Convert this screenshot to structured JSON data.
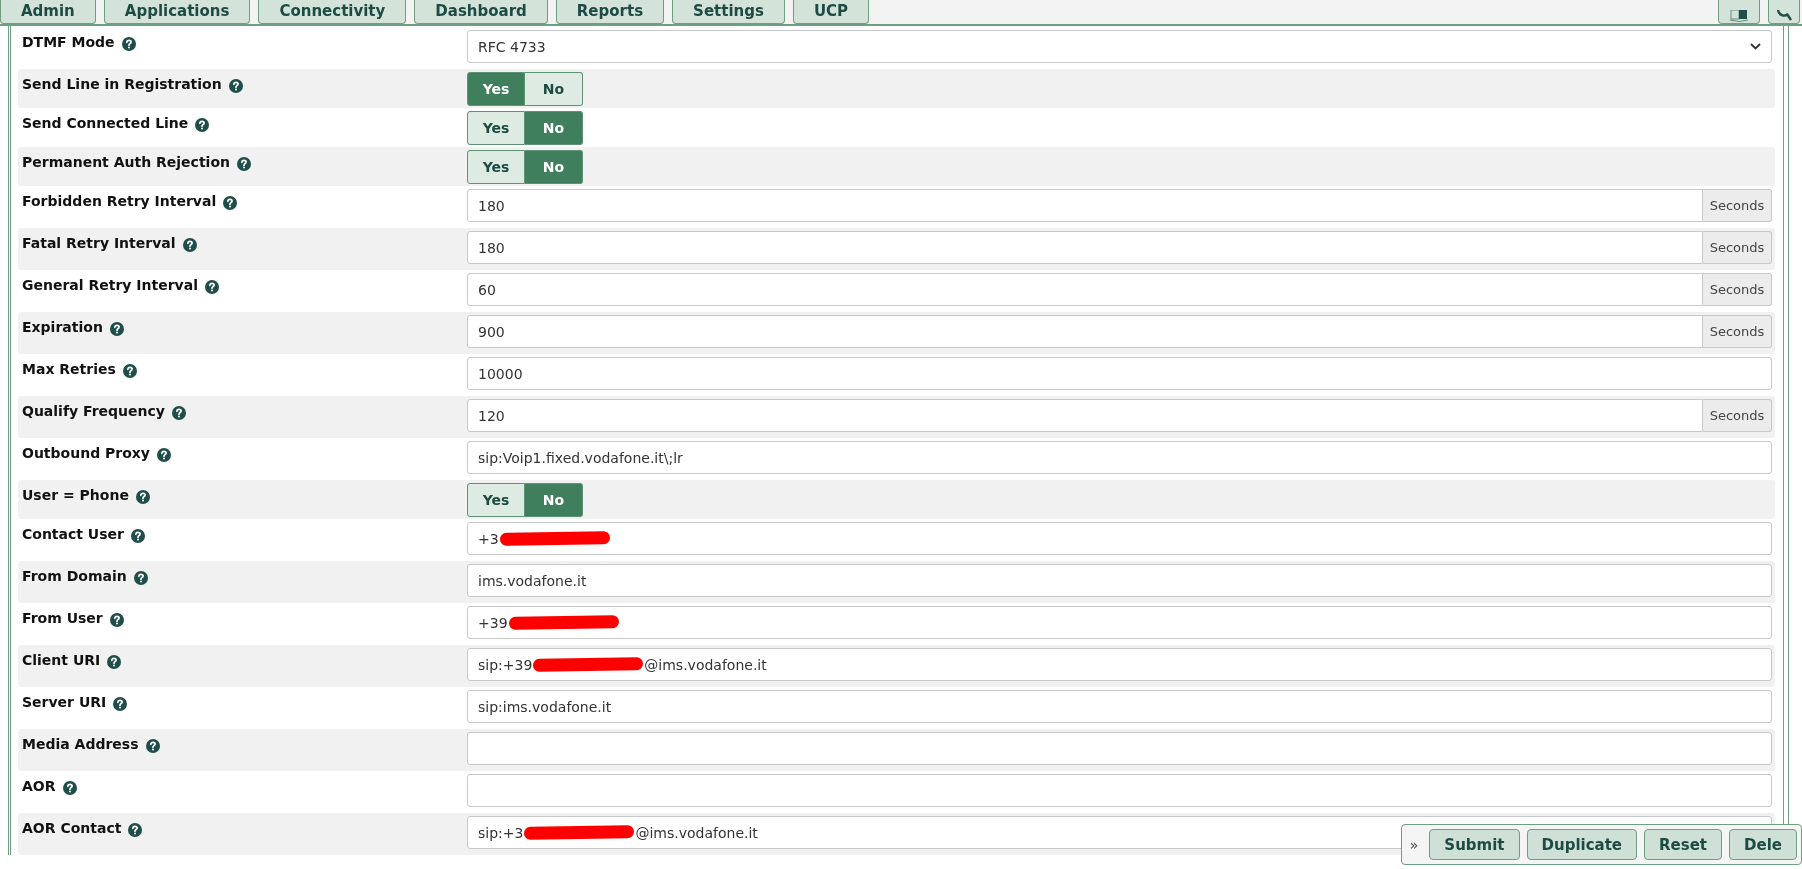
{
  "nav": {
    "tabs": [
      {
        "label": "Admin"
      },
      {
        "label": "Applications"
      },
      {
        "label": "Connectivity"
      },
      {
        "label": "Dashboard"
      },
      {
        "label": "Reports"
      },
      {
        "label": "Settings"
      },
      {
        "label": "UCP"
      }
    ]
  },
  "fields": [
    {
      "label": "DTMF Mode",
      "kind": "select",
      "value": "RFC 4733"
    },
    {
      "label": "Send Line in Registration",
      "kind": "toggle",
      "options": [
        {
          "label": "Yes",
          "selected": true
        },
        {
          "label": "No",
          "selected": false
        }
      ]
    },
    {
      "label": "Send Connected Line",
      "kind": "toggle",
      "options": [
        {
          "label": "Yes",
          "selected": false
        },
        {
          "label": "No",
          "selected": true
        }
      ]
    },
    {
      "label": "Permanent Auth Rejection",
      "kind": "toggle",
      "options": [
        {
          "label": "Yes",
          "selected": false
        },
        {
          "label": "No",
          "selected": true
        }
      ]
    },
    {
      "label": "Forbidden Retry Interval",
      "kind": "text",
      "value": "180",
      "unit": "Seconds"
    },
    {
      "label": "Fatal Retry Interval",
      "kind": "text",
      "value": "180",
      "unit": "Seconds"
    },
    {
      "label": "General Retry Interval",
      "kind": "text",
      "value": "60",
      "unit": "Seconds"
    },
    {
      "label": "Expiration",
      "kind": "text",
      "value": "900",
      "unit": "Seconds"
    },
    {
      "label": "Max Retries",
      "kind": "text",
      "value": "10000"
    },
    {
      "label": "Qualify Frequency",
      "kind": "text",
      "value": "120",
      "unit": "Seconds"
    },
    {
      "label": "Outbound Proxy",
      "kind": "text",
      "value": "sip:Voip1.fixed.vodafone.it\\;lr"
    },
    {
      "label": "User = Phone",
      "kind": "toggle",
      "options": [
        {
          "label": "Yes",
          "selected": false
        },
        {
          "label": "No",
          "selected": true
        }
      ]
    },
    {
      "label": "Contact User",
      "kind": "text",
      "value": "+3",
      "redacted": true
    },
    {
      "label": "From Domain",
      "kind": "text",
      "value": "ims.vodafone.it"
    },
    {
      "label": "From User",
      "kind": "text",
      "value": "+39",
      "redacted": true
    },
    {
      "label": "Client URI",
      "kind": "text",
      "value": "sip:+39",
      "redacted": true,
      "value_after": "@ims.vodafone.it"
    },
    {
      "label": "Server URI",
      "kind": "text",
      "value": "sip:ims.vodafone.it"
    },
    {
      "label": "Media Address",
      "kind": "text"
    },
    {
      "label": "AOR",
      "kind": "text"
    },
    {
      "label": "AOR Contact",
      "kind": "text",
      "value": "sip:+3",
      "redacted": true,
      "value_after": "@ims.vodafone.it"
    }
  ],
  "action_bar": {
    "expander": "»",
    "buttons": [
      "Submit",
      "Duplicate",
      "Reset",
      "Dele"
    ]
  }
}
